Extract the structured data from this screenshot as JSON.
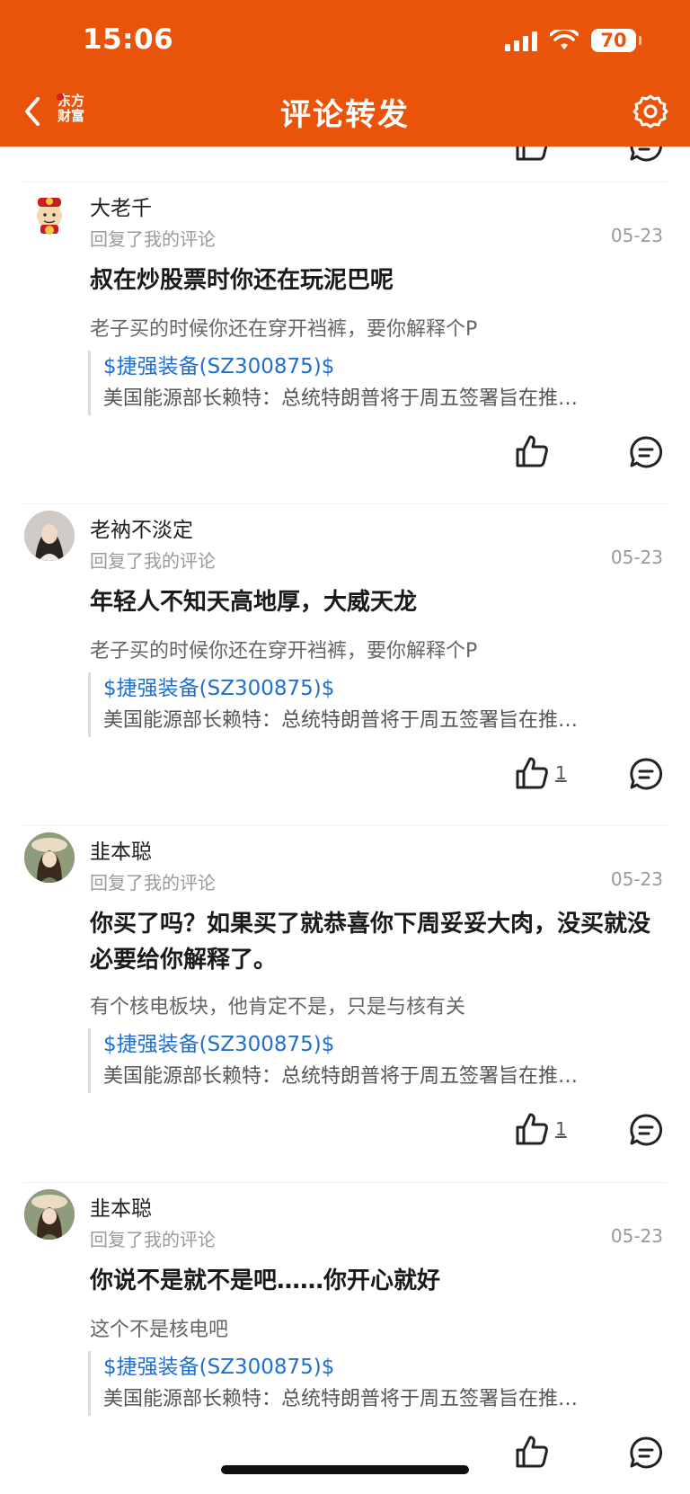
{
  "status": {
    "time": "15:06",
    "battery": "70"
  },
  "nav": {
    "title": "评论转发",
    "logo_line1": "东方",
    "logo_line2": "财富"
  },
  "comments": [
    {
      "user": "大老千",
      "subtitle": "回复了我的评论",
      "date": "05-23",
      "reply": "叔在炒股票时你还在玩泥巴呢",
      "original": "老子买的时候你还在穿开裆裤，要你解释个P",
      "stock": "$捷强装备(SZ300875)$",
      "news": "美国能源部长赖特：总统特朗普将于周五签署旨在推…",
      "likes": ""
    },
    {
      "user": "老衲不淡定",
      "subtitle": "回复了我的评论",
      "date": "05-23",
      "reply": "年轻人不知天高地厚，大威天龙",
      "original": "老子买的时候你还在穿开裆裤，要你解释个P",
      "stock": "$捷强装备(SZ300875)$",
      "news": "美国能源部长赖特：总统特朗普将于周五签署旨在推…",
      "likes": "1"
    },
    {
      "user": "韭本聪",
      "subtitle": "回复了我的评论",
      "date": "05-23",
      "reply": "你买了吗？如果买了就恭喜你下周妥妥大肉，没买就没必要给你解释了。",
      "original": "有个核电板块，他肯定不是，只是与核有关",
      "stock": "$捷强装备(SZ300875)$",
      "news": "美国能源部长赖特：总统特朗普将于周五签署旨在推…",
      "likes": "1"
    },
    {
      "user": "韭本聪",
      "subtitle": "回复了我的评论",
      "date": "05-23",
      "reply": "你说不是就不是吧……你开心就好",
      "original": "这个不是核电吧",
      "stock": "$捷强装备(SZ300875)$",
      "news": "美国能源部长赖特：总统特朗普将于周五签署旨在推…",
      "likes": ""
    }
  ],
  "colors": {
    "brand": "#E9530A",
    "link": "#1f6fd1"
  },
  "icons": [
    "chevron-left-icon",
    "gear-icon",
    "thumbs-up-icon",
    "comment-icon"
  ]
}
